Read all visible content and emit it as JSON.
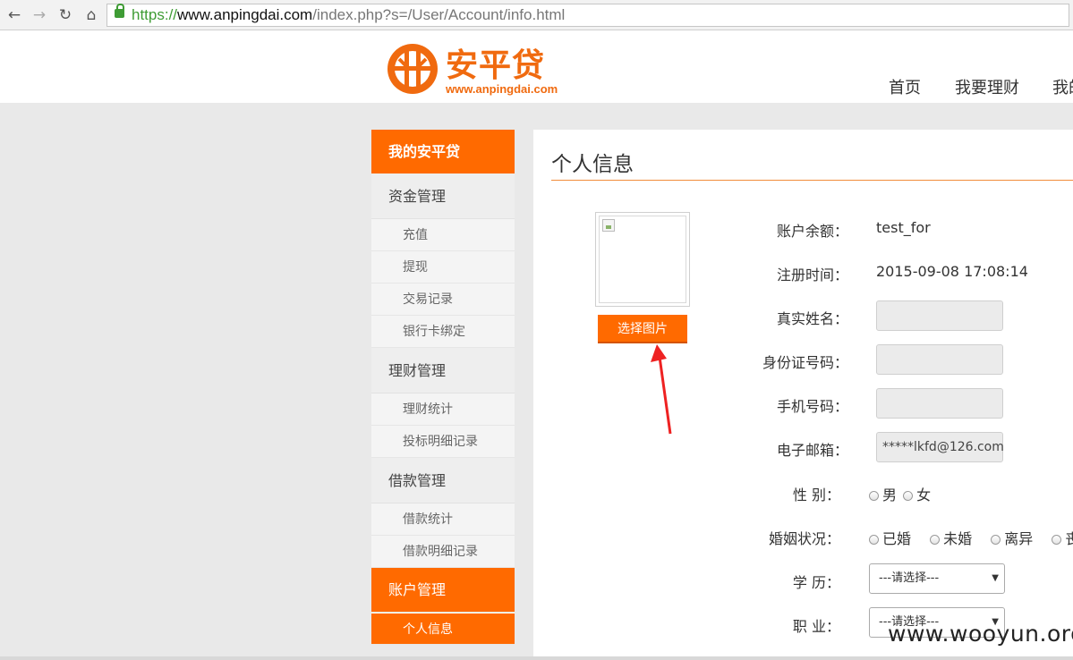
{
  "browser": {
    "back_icon": "arrow-left-icon",
    "forward_icon": "arrow-right-icon",
    "reload_icon": "reload-icon",
    "home_icon": "home-icon",
    "lock_icon": "lock-icon",
    "url_scheme": "https://",
    "url_host": "www.anpingdai.com",
    "url_path": "/index.php?s=/User/Account/info.html"
  },
  "header": {
    "brand_name": "安平贷",
    "brand_url": "www.anpingdai.com",
    "brand_color": "#f06a0f",
    "nav": [
      "首页",
      "我要理财",
      "我的"
    ]
  },
  "sidebar": {
    "title": "我的安平贷",
    "groups": [
      {
        "label": "资金管理",
        "items": [
          "充值",
          "提现",
          "交易记录",
          "银行卡绑定"
        ]
      },
      {
        "label": "理财管理",
        "items": [
          "理财统计",
          "投标明细记录"
        ]
      },
      {
        "label": "借款管理",
        "items": [
          "借款统计",
          "借款明细记录"
        ]
      },
      {
        "label": "账户管理",
        "items": [
          "个人信息"
        ]
      }
    ],
    "accent": "#ff6a00"
  },
  "main": {
    "title": "个人信息",
    "choose_image_label": "选择图片",
    "fields": {
      "balance_label": "账户余额：",
      "balance_value": "test_for",
      "reg_time_label": "注册时间：",
      "reg_time_value": "2015-09-08 17:08:14",
      "real_name_label": "真实姓名：",
      "id_no_label": "身份证号码：",
      "phone_label": "手机号码：",
      "email_label": "电子邮箱：",
      "email_value": "*****lkfd@126.com",
      "gender_label": "性 别：",
      "gender_options": [
        "男",
        "女"
      ],
      "marital_label": "婚姻状况：",
      "marital_options": [
        "已婚",
        "未婚",
        "离异",
        "丧偶"
      ],
      "education_label": "学 历：",
      "education_value": "---请选择---",
      "job_label": "职 业：",
      "job_value": "---请选择---"
    }
  },
  "watermark": "www.wooyun.org"
}
